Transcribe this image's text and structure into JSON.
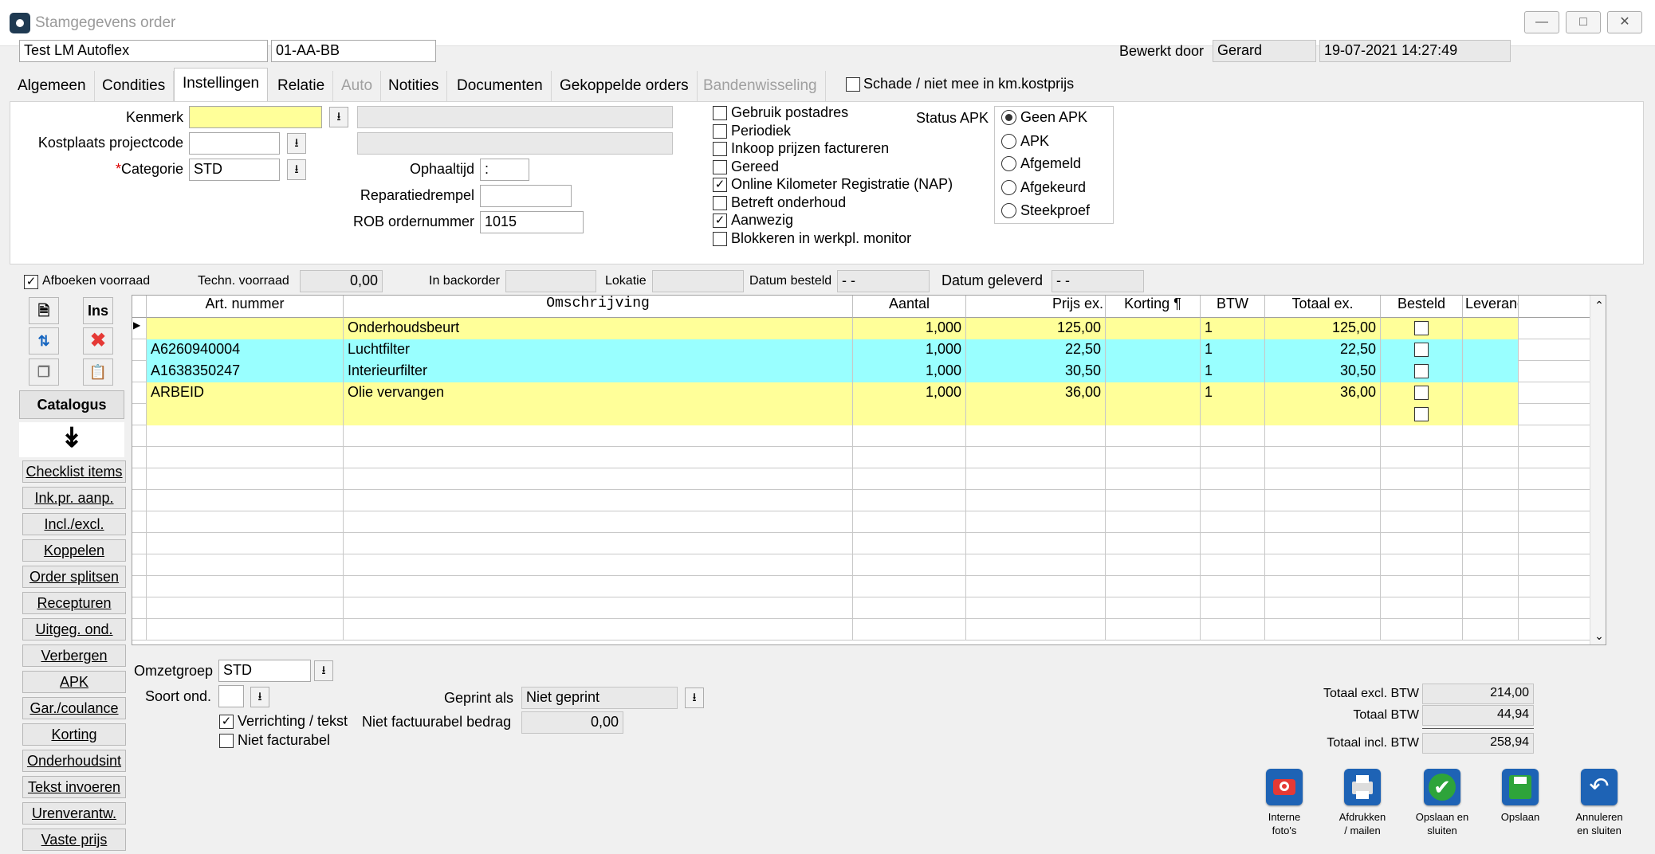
{
  "window": {
    "title": "Stamgegevens order"
  },
  "header": {
    "customer": "Test LM Autoflex",
    "plate": "01-AA-BB",
    "edited_by_label": "Bewerkt door",
    "edited_by": "Gerard",
    "edited_at": "19-07-2021 14:27:49"
  },
  "tabs": [
    {
      "label": "Algemeen"
    },
    {
      "label": "Condities"
    },
    {
      "label": "Instellingen"
    },
    {
      "label": "Relatie"
    },
    {
      "label": "Auto"
    },
    {
      "label": "Notities"
    },
    {
      "label": "Documenten"
    },
    {
      "label": "Gekoppelde orders"
    },
    {
      "label": "Bandenwisseling"
    }
  ],
  "damage_label": "Schade / niet mee in km.kostprijs",
  "settings": {
    "kenmerk_label": "Kenmerk",
    "kostplaats_label": "Kostplaats projectcode",
    "categorie_label": "Categorie",
    "categorie_required": "*",
    "categorie_value": "STD",
    "ophaaltijd_label": "Ophaaltijd",
    "ophaaltijd_value": ":",
    "reparatiedrempel_label": "Reparatiedrempel",
    "rob_label": "ROB ordernummer",
    "rob_value": "1015",
    "checkboxes": [
      {
        "label": "Gebruik postadres",
        "checked": false
      },
      {
        "label": "Periodiek",
        "checked": false
      },
      {
        "label": "Inkoop prijzen factureren",
        "checked": false
      },
      {
        "label": "Gereed",
        "checked": false
      },
      {
        "label": "Online Kilometer Registratie (NAP)",
        "checked": true
      },
      {
        "label": "Betreft onderhoud",
        "checked": false
      },
      {
        "label": "Aanwezig",
        "checked": true
      },
      {
        "label": "Blokkeren in werkpl. monitor",
        "checked": false
      }
    ],
    "apk_label": "Status APK",
    "apk_options": [
      {
        "label": "Geen APK",
        "selected": true
      },
      {
        "label": "APK",
        "selected": false
      },
      {
        "label": "Afgemeld",
        "selected": false
      },
      {
        "label": "Afgekeurd",
        "selected": false
      },
      {
        "label": "Steekproef",
        "selected": false
      }
    ]
  },
  "stockbar": {
    "afboeken_label": "Afboeken voorraad",
    "techn_label": "Techn. voorraad",
    "techn_value": "0,00",
    "backorder_label": "In backorder",
    "lokatie_label": "Lokatie",
    "besteld_label": "Datum besteld",
    "besteld_value": "- -",
    "geleverd_label": "Datum geleverd",
    "geleverd_value": "- -"
  },
  "side": {
    "ins_label": "Ins",
    "catalogus_label": "Catalogus",
    "buttons": [
      "Checklist items",
      "Ink.pr. aanp.",
      "Incl./excl.",
      "Koppelen",
      "Order splitsen",
      "Recepturen",
      "Uitgeg. ond.",
      "Verbergen",
      "APK",
      "Gar./coulance",
      "Korting",
      "Onderhoudsint",
      "Tekst invoeren",
      "Urenverantw.",
      "Vaste prijs"
    ]
  },
  "grid": {
    "columns": [
      "Art. nummer",
      "Omschrijving",
      "Aantal",
      "Prijs ex.",
      "Korting ¶",
      "BTW",
      "Totaal ex.",
      "Besteld",
      "Leveranc"
    ],
    "rows": [
      {
        "art": "",
        "desc": "Onderhoudsbeurt",
        "qty": "1,000",
        "price": "125,00",
        "disc": "",
        "btw": "1",
        "total": "125,00",
        "color": "#ffff99"
      },
      {
        "art": "A6260940004",
        "desc": "Luchtfilter",
        "qty": "1,000",
        "price": "22,50",
        "disc": "",
        "btw": "1",
        "total": "22,50",
        "color": "#99ffff"
      },
      {
        "art": "A1638350247",
        "desc": "Interieurfilter",
        "qty": "1,000",
        "price": "30,50",
        "disc": "",
        "btw": "1",
        "total": "30,50",
        "color": "#99ffff"
      },
      {
        "art": "ARBEID",
        "desc": "Olie vervangen",
        "qty": "1,000",
        "price": "36,00",
        "disc": "",
        "btw": "1",
        "total": "36,00",
        "color": "#ffff99"
      },
      {
        "art": "",
        "desc": "",
        "qty": "",
        "price": "",
        "disc": "",
        "btw": "",
        "total": "",
        "color": "#ffff99"
      }
    ]
  },
  "footer": {
    "omzetgroep_label": "Omzetgroep",
    "omzetgroep_value": "STD",
    "soort_label": "Soort ond.",
    "verrichting_label": "Verrichting / tekst",
    "niet_factureerbaar_label": "Niet facturabel",
    "geprint_label": "Geprint als",
    "geprint_value": "Niet geprint",
    "niet_bedrag_label": "Niet factuurabel bedrag",
    "niet_bedrag_value": "0,00"
  },
  "totals": {
    "excl_label": "Totaal excl. BTW",
    "excl_value": "214,00",
    "btw_label": "Totaal BTW",
    "btw_value": "44,94",
    "incl_label": "Totaal incl. BTW",
    "incl_value": "258,94"
  },
  "actions": [
    {
      "label1": "Interne",
      "label2": "foto's",
      "icon": "camera-icon",
      "color": "#1565c0"
    },
    {
      "label1": "Afdrukken",
      "label2": "/ mailen",
      "icon": "printer-icon",
      "color": "#1565c0"
    },
    {
      "label1": "Opslaan en",
      "label2": "sluiten",
      "icon": "check-icon",
      "color": "#1565c0"
    },
    {
      "label1": "Opslaan",
      "label2": "",
      "icon": "save-icon",
      "color": "#1565c0"
    },
    {
      "label1": "Annuleren",
      "label2": "en sluiten",
      "icon": "undo-icon",
      "color": "#1565c0"
    }
  ]
}
